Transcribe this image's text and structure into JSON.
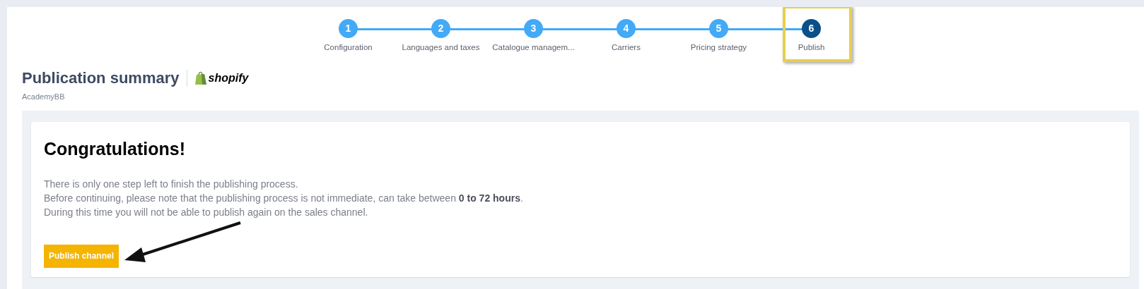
{
  "steps": [
    {
      "number": "1",
      "label": "Configuration",
      "selected": false
    },
    {
      "number": "2",
      "label": "Languages and taxes",
      "selected": false
    },
    {
      "number": "3",
      "label": "Catalogue managem...",
      "selected": false
    },
    {
      "number": "4",
      "label": "Carriers",
      "selected": false
    },
    {
      "number": "5",
      "label": "Pricing strategy",
      "selected": false
    },
    {
      "number": "6",
      "label": "Publish",
      "selected": true
    }
  ],
  "header": {
    "title": "Publication summary",
    "brand": "shopify",
    "subtitle": "AcademyBB"
  },
  "card": {
    "heading": "Congratulations!",
    "lines": [
      "There is only one step left to finish the publishing process.",
      "Before continuing, please note that the publishing process is not immediate, can take between **0 to 72 hours**.",
      "During this time you will not be able to publish again on the sales channel."
    ],
    "button": "Publish channel"
  }
}
